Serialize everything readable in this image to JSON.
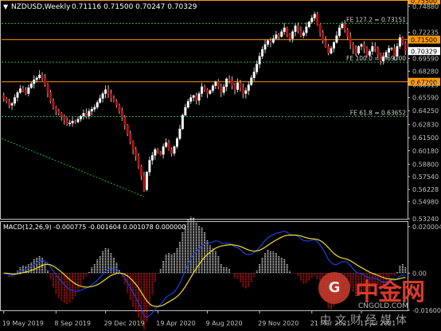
{
  "header": {
    "symbol_label": "NZDUSD,Weekly",
    "ohlc_label": "0.71116 0.71500 0.70247 0.70329",
    "macd_label": "MACD(12,26,9) -0.000775 -0.001604 0.001078 0.000000"
  },
  "colors": {
    "background": "#000000",
    "axis": "#c0c0c0",
    "bull_body": "#ffffff",
    "bear_body": "#c0100e",
    "wick": "#c8c8c8",
    "hline": "#ff9900",
    "fib_line": "#21b34a",
    "macd_main": "#1a3fe0",
    "macd_signal": "#f0e020",
    "hist_pos": "#e8e8e8",
    "hist_neg": "#e01818"
  },
  "chart_data": [
    {
      "type": "candlestick",
      "title": "NZDUSD,Weekly",
      "ylim": [
        0.5324,
        0.7545
      ],
      "y_ticks": [
        0.7488,
        0.72235,
        0.70329,
        0.6959,
        0.6828,
        0.66915,
        0.6559,
        0.6425,
        0.6283,
        0.615,
        0.6018,
        0.588,
        0.5754,
        0.56228,
        0.5498,
        0.5324
      ],
      "y_tick_labels": [
        "0.74880",
        "0.72235",
        "0.70329",
        "0.69590",
        "0.68280",
        "0.66915",
        "0.65590",
        "0.64250",
        "0.62830",
        "0.61500",
        "0.60180",
        "0.58800",
        "0.57540",
        "0.56228",
        "0.54980",
        "0.53240"
      ],
      "x_tick_labels": [
        "19 May 2019",
        "8 Sep 2019",
        "29 Dec 2019",
        "19 Apr 2020",
        "9 Aug 2020",
        "29 Nov 2020",
        "21 Mar 2021",
        "11 Jul 2021"
      ],
      "price_levels": [
        {
          "value": 0.755,
          "label": "0.75500",
          "kind": "horizontal"
        },
        {
          "value": 0.715,
          "label": "0.71500",
          "kind": "horizontal"
        },
        {
          "value": 0.672,
          "label": "0.67200",
          "kind": "horizontal"
        }
      ],
      "fib_levels": [
        {
          "value": 0.73151,
          "label": "FE 127.2 = 0.73151"
        },
        {
          "value": 0.692,
          "label": "FE 100.0 = 0.69200"
        },
        {
          "value": 0.63652,
          "label": "FE 61.8 = 0.63652"
        }
      ],
      "current_price": {
        "value": 0.70329,
        "label": "0.70329"
      },
      "closes": [
        0.655,
        0.652,
        0.648,
        0.65,
        0.656,
        0.661,
        0.665,
        0.663,
        0.66,
        0.666,
        0.67,
        0.674,
        0.676,
        0.679,
        0.676,
        0.669,
        0.661,
        0.652,
        0.646,
        0.642,
        0.64,
        0.637,
        0.633,
        0.629,
        0.63,
        0.632,
        0.631,
        0.634,
        0.637,
        0.64,
        0.637,
        0.642,
        0.644,
        0.646,
        0.651,
        0.655,
        0.66,
        0.664,
        0.66,
        0.655,
        0.652,
        0.648,
        0.642,
        0.636,
        0.628,
        0.619,
        0.611,
        0.603,
        0.596,
        0.586,
        0.576,
        0.562,
        0.58,
        0.592,
        0.597,
        0.603,
        0.6,
        0.598,
        0.606,
        0.61,
        0.603,
        0.599,
        0.606,
        0.614,
        0.624,
        0.638,
        0.646,
        0.652,
        0.656,
        0.658,
        0.653,
        0.66,
        0.667,
        0.664,
        0.66,
        0.663,
        0.668,
        0.672,
        0.667,
        0.661,
        0.667,
        0.675,
        0.673,
        0.668,
        0.664,
        0.671,
        0.666,
        0.66,
        0.663,
        0.669,
        0.676,
        0.682,
        0.69,
        0.698,
        0.705,
        0.71,
        0.714,
        0.712,
        0.716,
        0.72,
        0.718,
        0.723,
        0.727,
        0.72,
        0.716,
        0.723,
        0.729,
        0.724,
        0.719,
        0.722,
        0.728,
        0.733,
        0.737,
        0.741,
        0.73,
        0.722,
        0.714,
        0.708,
        0.701,
        0.706,
        0.712,
        0.719,
        0.727,
        0.731,
        0.725,
        0.718,
        0.71,
        0.705,
        0.701,
        0.708,
        0.71,
        0.706,
        0.699,
        0.703,
        0.708,
        0.706,
        0.7,
        0.693,
        0.697,
        0.702,
        0.706,
        0.706,
        0.698,
        0.708,
        0.717,
        0.711,
        0.704
      ]
    },
    {
      "type": "histogram+line",
      "title": "MACD(12,26,9)",
      "values_label": "-0.000775 -0.001604 0.001078 0.000000",
      "ylim": [
        -0.016,
        0.022
      ],
      "y_ticks": [
        0.020004,
        0.0,
        -0.016004
      ],
      "y_tick_labels": [
        "0.020004",
        "0.00",
        "-0.016004"
      ],
      "series": [
        {
          "role": "histogram"
        },
        {
          "role": "main"
        },
        {
          "role": "signal"
        }
      ]
    }
  ]
}
